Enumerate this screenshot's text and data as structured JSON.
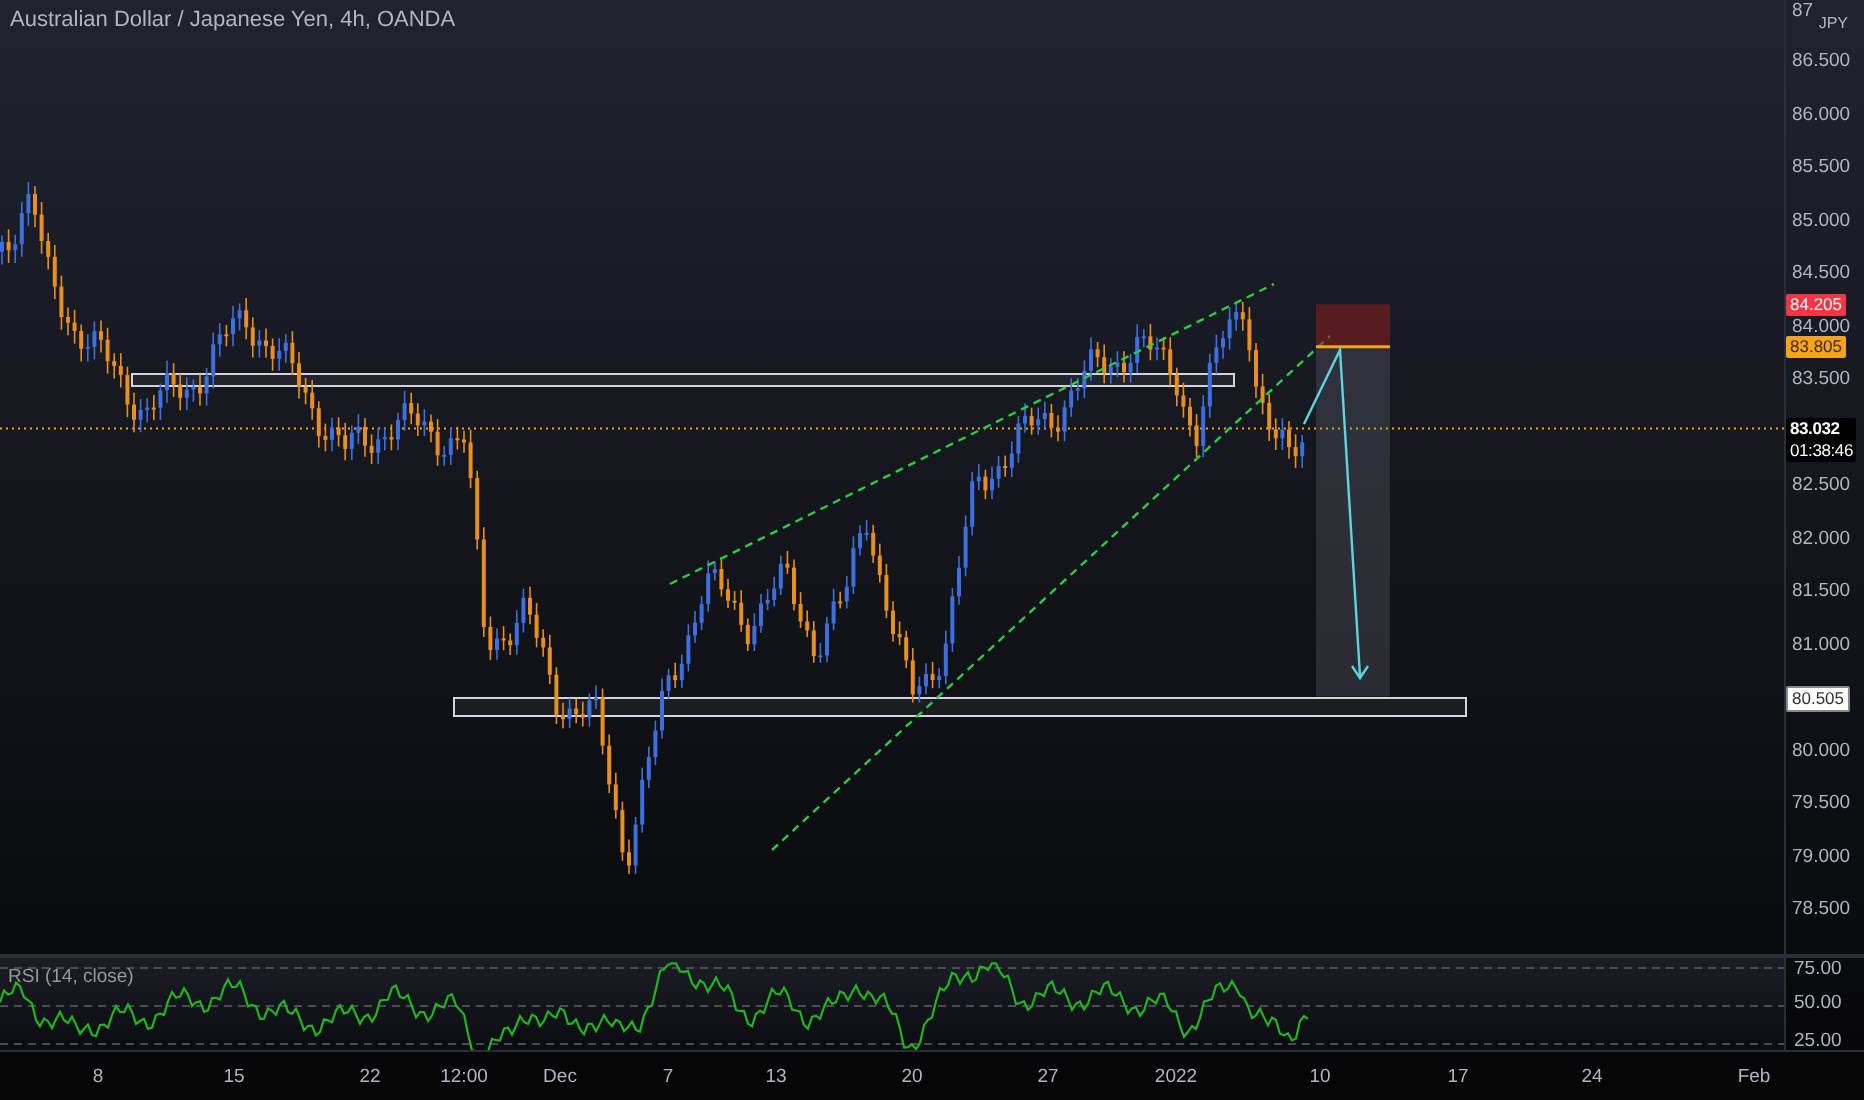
{
  "header": {
    "title": "Australian Dollar / Japanese Yen, 4h, OANDA"
  },
  "price_axis": {
    "currency": "JPY",
    "ticks": [
      "87",
      "86.500",
      "86.000",
      "85.500",
      "85.000",
      "84.500",
      "84.000",
      "83.500",
      "82.500",
      "82.000",
      "81.500",
      "81.000",
      "80.000",
      "79.500",
      "79.000",
      "78.500"
    ]
  },
  "price_badges": [
    {
      "kind": "stop",
      "text": "84.205",
      "color": "#f23645"
    },
    {
      "kind": "entry",
      "text": "83.805",
      "color": "#f7a21b"
    },
    {
      "kind": "last",
      "text": "83.032",
      "countdown": "01:38:46",
      "color": "#000000"
    },
    {
      "kind": "target",
      "text": "80.505",
      "color": "#ffffff"
    }
  ],
  "rsi": {
    "label": "RSI (14, close)",
    "ticks": [
      "75.00",
      "50.00",
      "25.00"
    ]
  },
  "time_axis": {
    "labels": [
      "8",
      "15",
      "22",
      "12:00",
      "Dec",
      "7",
      "13",
      "20",
      "27",
      "2022",
      "10",
      "17",
      "24",
      "Feb"
    ]
  }
}
